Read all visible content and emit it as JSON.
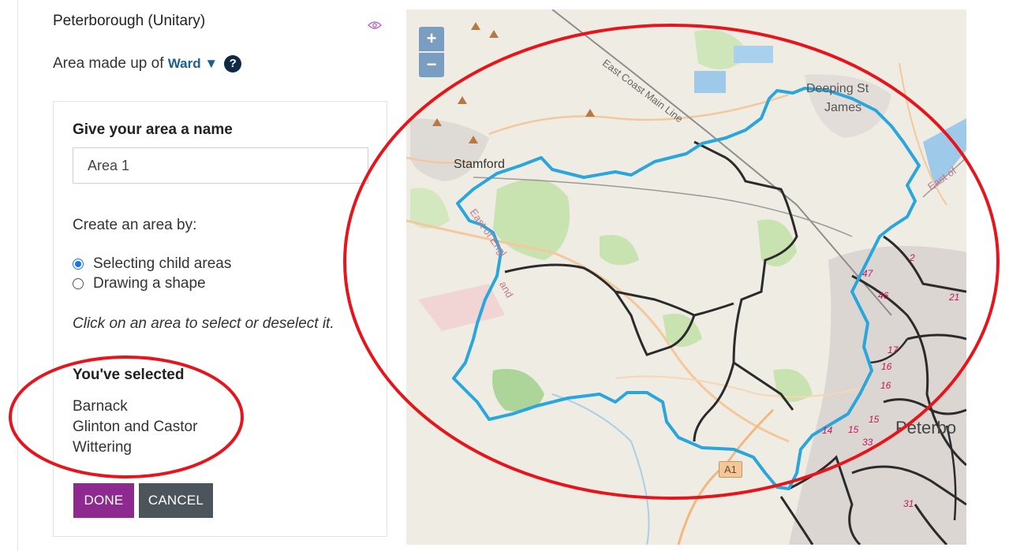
{
  "panel": {
    "area_title": "Peterborough (Unitary)",
    "made_up_prefix": "Area made up of ",
    "made_up_type": "Ward",
    "dropdown_arrow": "▼",
    "help_symbol": "?"
  },
  "form": {
    "heading": "Give your area a name",
    "name_value": "Area 1",
    "create_by_label": "Create an area by:",
    "options": [
      {
        "label": "Selecting child areas",
        "checked": true
      },
      {
        "label": "Drawing a shape",
        "checked": false
      }
    ],
    "instruction": "Click on an area to select or deselect it.",
    "selected_heading": "You've selected",
    "selected_items": [
      "Barnack",
      "Glinton and Castor",
      "Wittering"
    ],
    "done_label": "DONE",
    "cancel_label": "CANCEL"
  },
  "map": {
    "zoom_in": "+",
    "zoom_out": "−",
    "places": {
      "stamford": "Stamford",
      "deeping_1": "Deeping St",
      "deeping_2": "James",
      "peterborough": "Peterbo",
      "road_a1": "A1",
      "rail_ecml": "East Coast Main Line",
      "east_of_england_1": "East of Engl",
      "east_of_england_2": "and",
      "east_of_right": "East of"
    },
    "ward_numbers": [
      "47",
      "46",
      "2",
      "21",
      "17",
      "16",
      "16",
      "15",
      "15",
      "14",
      "33",
      "31"
    ],
    "colors": {
      "selection_outline": "#2aa6dd",
      "ward_border": "#2b2b2b",
      "annotation": "#e8141b"
    }
  },
  "colors": {
    "done_button": "#8e2a8f",
    "cancel_button": "#4d555c",
    "link": "#1b5f8f"
  }
}
